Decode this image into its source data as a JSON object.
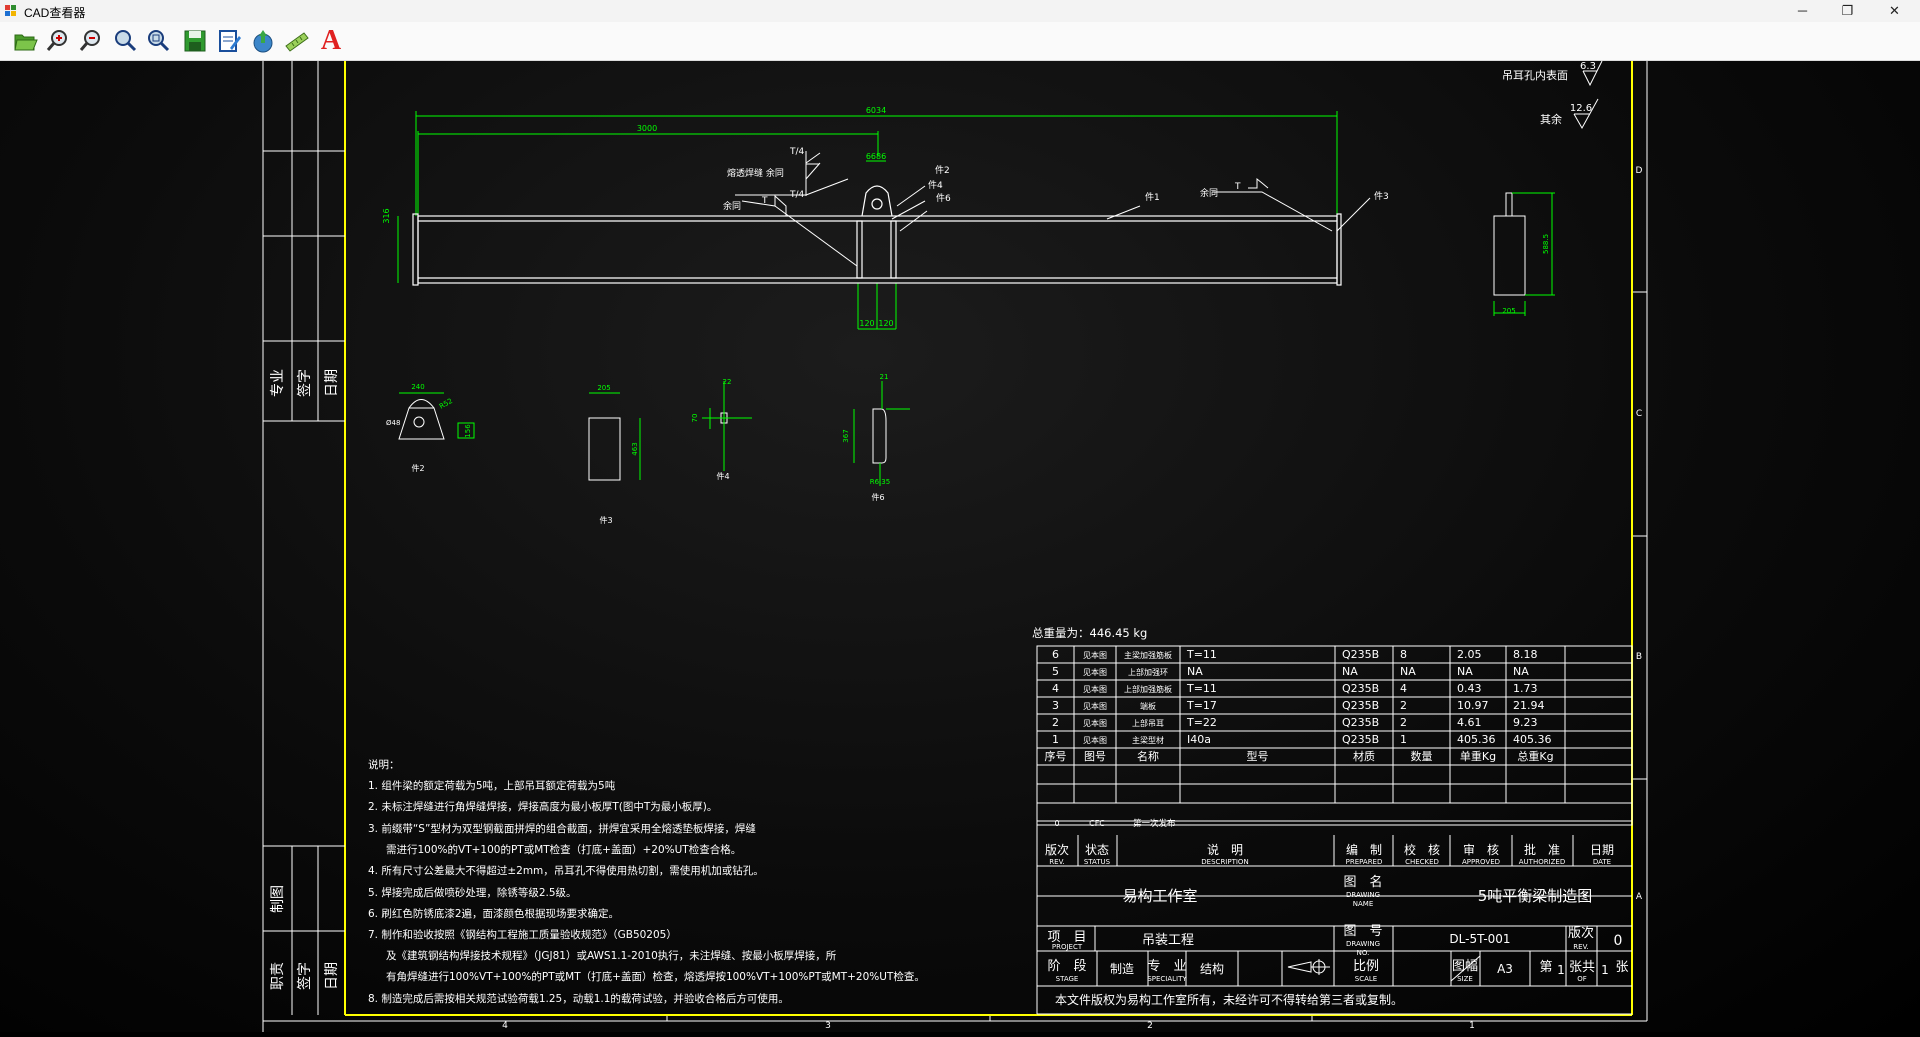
{
  "window": {
    "title": "CAD查看器",
    "controls": {
      "minimize": "─",
      "maximize": "❐",
      "close": "✕"
    }
  },
  "toolbar": {
    "tools": [
      {
        "name": "open-file-icon"
      },
      {
        "name": "zoom-in-icon"
      },
      {
        "name": "zoom-out-icon"
      },
      {
        "name": "zoom-window-icon"
      },
      {
        "name": "zoom-extents-icon"
      },
      {
        "name": "save-icon"
      },
      {
        "name": "edit-document-icon"
      },
      {
        "name": "export-icon"
      },
      {
        "name": "measure-icon"
      },
      {
        "name": "text-tool-icon",
        "label": "A"
      }
    ]
  },
  "drawing": {
    "surface_roughness": {
      "hole_label": "吊耳孔内表面",
      "hole_value": "6.3",
      "other_label": "其余",
      "other_value": "12.6"
    },
    "main_view": {
      "dim_total": "6034",
      "dim_half": "3000",
      "dim_height": "316",
      "dim_lug": "6686",
      "dim_gap_left": "120",
      "dim_gap_right": "120",
      "weld_note": "熔透焊缝 余同",
      "weld_t4_a": "T/4",
      "weld_t4_b": "T/4",
      "weld_left": "余同",
      "weld_right": "余同",
      "weld_t": "T",
      "weld_t2": "T",
      "part2": "件2",
      "part4": "件4",
      "part6": "件6",
      "part1": "件1",
      "part3": "件3"
    },
    "side_view": {
      "height": "588.5",
      "width": "205"
    },
    "detail_parts": {
      "p2": {
        "label": "件2",
        "w": "240",
        "r": "R52",
        "hole": "Ø48",
        "h": "156"
      },
      "p3": {
        "label": "件3",
        "w": "205",
        "h": "463"
      },
      "p4": {
        "label": "件4",
        "w": "22",
        "h": "70"
      },
      "p6": {
        "label": "件6",
        "w": "21",
        "h": "367",
        "r": "R6.35"
      }
    },
    "left_panel": {
      "top": [
        "专业",
        "签字",
        "日期"
      ],
      "mid": [
        "制图"
      ],
      "bottom": [
        "职责",
        "签字",
        "日期"
      ]
    },
    "zones_right": [
      "D",
      "C",
      "B",
      "A"
    ],
    "zones_bottom": [
      "4",
      "3",
      "2",
      "1"
    ],
    "notes": {
      "heading": "说明：",
      "items": [
        "1.  组件梁的额定荷载为5吨，上部吊耳额定荷载为5吨",
        "2.  未标注焊缝进行角焊缝焊接，焊接高度为最小板厚T(图中T为最小板厚)。",
        "3.  前缀带“S”型材为双型钢截面拼焊的组合截面，拼焊宜采用全熔透垫板焊接，焊缝",
        "需进行100%的VT+100的PT或MT检查（打底+盖面）+20%UT检查合格。",
        "4.  所有尺寸公差最大不得超过±2mm，吊耳孔不得使用热切割，需使用机加或钻孔。",
        "5.  焊接完成后做喷砂处理，除锈等级2.5级。",
        "6.  刷红色防锈底漆2遍，面漆颜色根据现场要求确定。",
        "7.  制作和验收按照《钢结构工程施工质量验收规范》（GB50205）",
        "及《建筑钢结构焊接技术规程》（JGJ81）或AWS1.1-2010执行，未注焊缝、按最小板厚焊接，所",
        "有角焊缝进行100%VT+100%的PT或MT（打底+盖面）检查，熔透焊按100%VT+100%PT或MT+20%UT检查。",
        "8.  制造完成后需按相关规范试验荷载1.25，动载1.1的载荷试验，并验收合格后方可使用。"
      ]
    },
    "bom": {
      "total_weight": "总重量为：446.45 kg",
      "rows": [
        [
          "6",
          "见本图",
          "主梁加强筋板",
          "T=11",
          "Q235B",
          "8",
          "2.05",
          "8.18"
        ],
        [
          "5",
          "见本图",
          "上部加强环",
          "NA",
          "NA",
          "NA",
          "NA",
          "NA"
        ],
        [
          "4",
          "见本图",
          "上部加强筋板",
          "T=11",
          "Q235B",
          "4",
          "0.43",
          "1.73"
        ],
        [
          "3",
          "见本图",
          "端板",
          "T=17",
          "Q235B",
          "2",
          "10.97",
          "21.94"
        ],
        [
          "2",
          "见本图",
          "上部吊耳",
          "T=22",
          "Q235B",
          "2",
          "4.61",
          "9.23"
        ],
        [
          "1",
          "见本图",
          "主梁型材",
          "I40a",
          "Q235B",
          "1",
          "405.36",
          "405.36"
        ]
      ],
      "header": [
        "序号",
        "图号",
        "名称",
        "型号",
        "材质",
        "数量",
        "单重Kg",
        "总重Kg"
      ]
    },
    "title_block": {
      "rev_no": "0",
      "rev_status": "CFC",
      "rev_desc": "第一次发布",
      "h_rev": "版次",
      "h_rev_en": "REV.",
      "h_status": "状态",
      "h_status_en": "STATUS",
      "h_desc": "说　明",
      "h_desc_en": "DESCRIPTION",
      "h_prepared": "编　制",
      "h_prepared_en": "PREPARED",
      "h_checked": "校　核",
      "h_checked_en": "CHECKED",
      "h_approved": "审　核",
      "h_approved_en": "APPROVED",
      "h_authorized": "批　准",
      "h_authorized_en": "AUTHORIZED",
      "h_date": "日期",
      "h_date_en": "DATE",
      "studio": "易构工作室",
      "drawing_name_label": "图　名",
      "drawing_name_en": "DRAWING",
      "drawing_name_en2": "NAME",
      "drawing_name": "5吨平衡梁制造图",
      "project_label": "项　目",
      "project_en": "PROJECT",
      "project": "吊装工程",
      "drawing_no_label": "图　号",
      "drawing_no_en": "DRAWING",
      "drawing_no_en2": "NO.",
      "drawing_no": "DL-5T-001",
      "rev_label": "版次",
      "rev_label_en": "REV.",
      "rev_value": "0",
      "stage_label": "阶　段",
      "stage_en": "STAGE",
      "stage": "制造",
      "specialty_label": "专　业",
      "specialty_en": "SPECIALITY",
      "specialty": "结构",
      "scale_label": "比例",
      "scale_en": "SCALE",
      "size_label": "图幅",
      "size_en": "SIZE",
      "size": "A3",
      "sheet_prefix": "第",
      "sheet_no": "1",
      "sheet_mid": "张共",
      "sheet_total": "1",
      "sheet_suffix": "张",
      "sheet_of": "OF",
      "copyright": "本文件版权为易构工作室所有，未经许可不得转给第三者或复制。"
    }
  },
  "colors": {
    "frame": "#ffff00",
    "line": "#ffffff",
    "dim": "#00ff00",
    "text": "#ffffff",
    "canvas": "#0b0b0b"
  }
}
